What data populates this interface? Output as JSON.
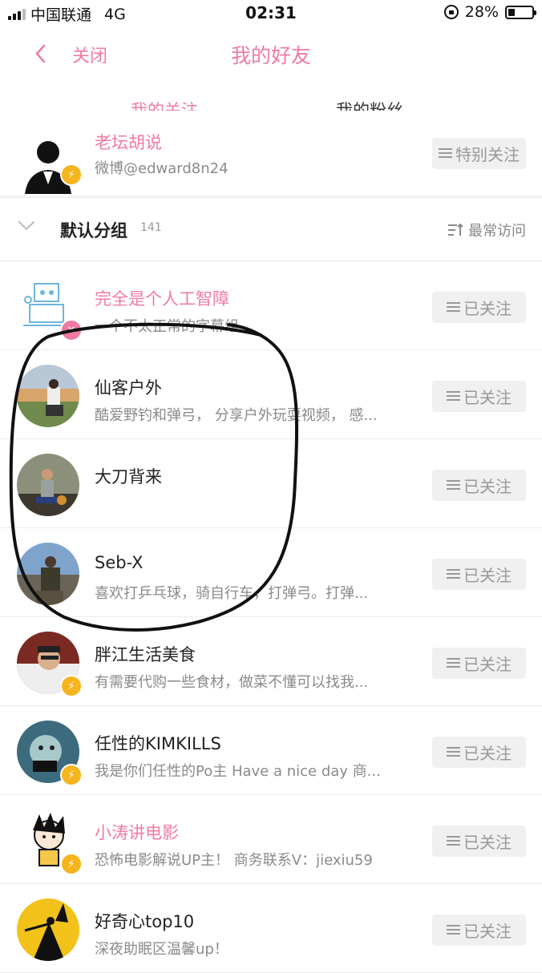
{
  "status_bar": {
    "carrier": "中国联通",
    "network": "4G",
    "time": "02:31",
    "battery": "28%"
  },
  "nav": {
    "close_label": "关闭",
    "title": "我的好友"
  },
  "tabs": {
    "following": "我的关注",
    "fans": "我的粉丝"
  },
  "top_partial_user": {
    "name": "老坛胡说",
    "desc": "微博@edward8n24",
    "button": "特别关注"
  },
  "group": {
    "name": "默认分组",
    "count": "141",
    "sort_label": "最常访问"
  },
  "users": [
    {
      "name": "完全是个人工智障",
      "desc": "一个不太正常的字幕组",
      "button": "已关注",
      "name_color": "#f07aa4"
    },
    {
      "name": "仙客户外",
      "desc": "酷爱野钓和弹弓， 分享户外玩耍视频， 感...",
      "button": "已关注"
    },
    {
      "name": "大刀背来",
      "desc": "",
      "button": "已关注"
    },
    {
      "name": "Seb-X",
      "desc": "喜欢打乒乓球，骑自行车，打弹弓。打弹...",
      "button": "已关注"
    },
    {
      "name": "胖江生活美食",
      "desc": "有需要代购一些食材，做菜不懂可以找我...",
      "button": "已关注"
    },
    {
      "name": "任性的KIMKILLS",
      "desc": "我是你们任性的Po主 Have a nice day 商...",
      "button": "已关注"
    },
    {
      "name": "小涛讲电影",
      "desc": "恐怖电影解说UP主！ 商务联系V：jiexiu59",
      "button": "已关注",
      "name_color": "#f07aa4"
    },
    {
      "name": "好奇心top10",
      "desc": "深夜助眠区温馨up！",
      "button": "已关注"
    }
  ],
  "colors": {
    "accent": "#f07aa4",
    "verified_badge": "#f6b51d",
    "button_bg": "#f0f0f0"
  },
  "icons": [
    "back-chevron-icon",
    "collapse-chevron-icon",
    "sort-icon",
    "menu-lines-icon",
    "verified-badge-icon"
  ]
}
